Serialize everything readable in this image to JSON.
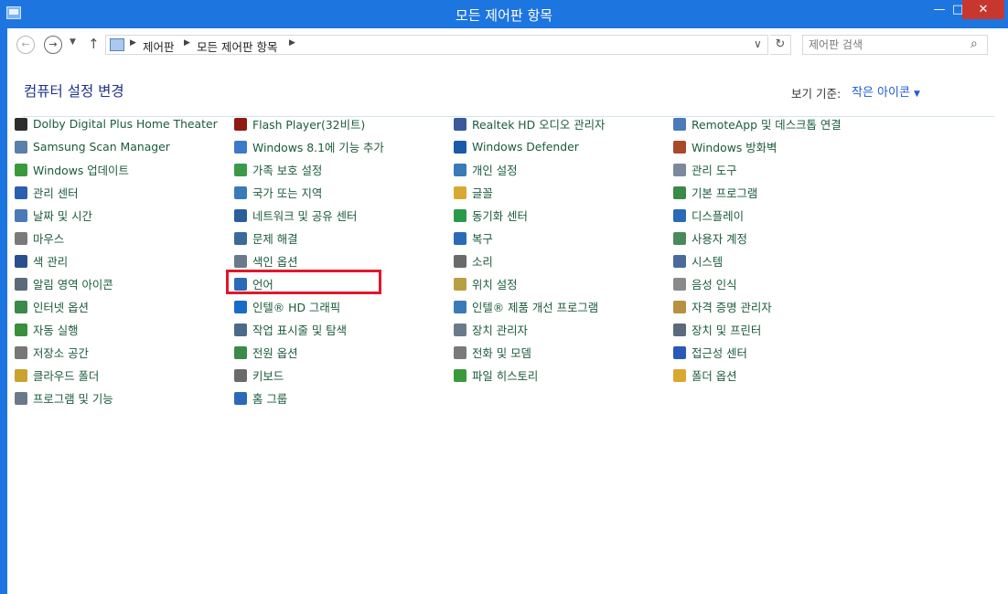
{
  "window": {
    "title": "모든 제어판 항목",
    "minimize": "—",
    "maximize": "□",
    "close": "✕"
  },
  "nav": {
    "back": "←",
    "forward": "→",
    "recent": "▼",
    "up": "↑",
    "breadcrumbs": [
      "제어판",
      "모든 제어판 항목"
    ],
    "separator": "▶",
    "dropdown": "∨",
    "refresh": "↻",
    "search_placeholder": "제어판 검색"
  },
  "header": {
    "title": "컴퓨터 설정 변경",
    "view_label": "보기 기준:",
    "view_value": "작은 아이콘"
  },
  "columns": [
    [
      {
        "label": "Dolby Digital Plus Home Theater",
        "icon": "dolby-icon",
        "color": "#2d2d2d"
      },
      {
        "label": "Samsung Scan Manager",
        "icon": "scanner-icon",
        "color": "#5a7fa8"
      },
      {
        "label": "Windows 업데이트",
        "icon": "windows-update-icon",
        "color": "#3a9a3a"
      },
      {
        "label": "관리 센터",
        "icon": "flag-icon",
        "color": "#2b5fb0"
      },
      {
        "label": "날짜 및 시간",
        "icon": "calendar-clock-icon",
        "color": "#4a7ab8"
      },
      {
        "label": "마우스",
        "icon": "mouse-icon",
        "color": "#7a7a7a"
      },
      {
        "label": "색 관리",
        "icon": "color-management-icon",
        "color": "#2a4f8f"
      },
      {
        "label": "알림 영역 아이콘",
        "icon": "notification-area-icon",
        "color": "#5d6a78"
      },
      {
        "label": "인터넷 옵션",
        "icon": "internet-options-icon",
        "color": "#3a8a4a"
      },
      {
        "label": "자동 실행",
        "icon": "autoplay-icon",
        "color": "#3a8f3a"
      },
      {
        "label": "저장소 공간",
        "icon": "storage-spaces-icon",
        "color": "#777777"
      },
      {
        "label": "클라우드 폴더",
        "icon": "work-folders-icon",
        "color": "#c9a230"
      },
      {
        "label": "프로그램 및 기능",
        "icon": "programs-features-icon",
        "color": "#6a7a8a"
      }
    ],
    [
      {
        "label": "Flash Player(32비트)",
        "icon": "flash-icon",
        "color": "#8e1a12"
      },
      {
        "label": "Windows 8.1에 기능 추가",
        "icon": "add-features-icon",
        "color": "#3a7ac8"
      },
      {
        "label": "가족 보호 설정",
        "icon": "family-safety-icon",
        "color": "#3a9a4a"
      },
      {
        "label": "국가 또는 지역",
        "icon": "region-icon",
        "color": "#3a7ab8"
      },
      {
        "label": "네트워크 및 공유 센터",
        "icon": "network-icon",
        "color": "#2a5f9a"
      },
      {
        "label": "문제 해결",
        "icon": "troubleshooting-icon",
        "color": "#3a6a9a"
      },
      {
        "label": "색인 옵션",
        "icon": "indexing-icon",
        "color": "#6a7a8a"
      },
      {
        "label": "언어",
        "icon": "language-icon",
        "color": "#2a6ab8"
      },
      {
        "label": "인텔® HD 그래픽",
        "icon": "intel-graphics-icon",
        "color": "#1a6ac8"
      },
      {
        "label": "작업 표시줄 및 탐색",
        "icon": "taskbar-icon",
        "color": "#4a6a8a"
      },
      {
        "label": "전원 옵션",
        "icon": "power-options-icon",
        "color": "#3a8a4a"
      },
      {
        "label": "키보드",
        "icon": "keyboard-icon",
        "color": "#6a6a6a"
      },
      {
        "label": "홈 그룹",
        "icon": "homegroup-icon",
        "color": "#2a6ab8"
      }
    ],
    [
      {
        "label": "Realtek HD 오디오 관리자",
        "icon": "realtek-audio-icon",
        "color": "#3a5a9a"
      },
      {
        "label": "Windows Defender",
        "icon": "defender-icon",
        "color": "#1a5aa8"
      },
      {
        "label": "개인 설정",
        "icon": "personalization-icon",
        "color": "#3a7ab8"
      },
      {
        "label": "글꼴",
        "icon": "fonts-icon",
        "color": "#d9a830"
      },
      {
        "label": "동기화 센터",
        "icon": "sync-center-icon",
        "color": "#2a9a4a"
      },
      {
        "label": "복구",
        "icon": "recovery-icon",
        "color": "#2a6ab8"
      },
      {
        "label": "소리",
        "icon": "sound-icon",
        "color": "#6a6a6a"
      },
      {
        "label": "위치 설정",
        "icon": "location-icon",
        "color": "#b8a040"
      },
      {
        "label": "인텔® 제품 개선 프로그램",
        "icon": "intel-improvement-icon",
        "color": "#3a7ab8"
      },
      {
        "label": "장치 관리자",
        "icon": "device-manager-icon",
        "color": "#6a7a8a"
      },
      {
        "label": "전화 및 모뎀",
        "icon": "phone-modem-icon",
        "color": "#7a7a7a"
      },
      {
        "label": "파일 히스토리",
        "icon": "file-history-icon",
        "color": "#3a9a3a"
      }
    ],
    [
      {
        "label": "RemoteApp 및 데스크톱 연결",
        "icon": "remoteapp-icon",
        "color": "#4a7ab8"
      },
      {
        "label": "Windows 방화벽",
        "icon": "firewall-icon",
        "color": "#a84a2a"
      },
      {
        "label": "관리 도구",
        "icon": "admin-tools-icon",
        "color": "#7a8a9a"
      },
      {
        "label": "기본 프로그램",
        "icon": "default-programs-icon",
        "color": "#3a8a4a"
      },
      {
        "label": "디스플레이",
        "icon": "display-icon",
        "color": "#2a6ab8"
      },
      {
        "label": "사용자 계정",
        "icon": "user-accounts-icon",
        "color": "#4a8a5a"
      },
      {
        "label": "시스템",
        "icon": "system-icon",
        "color": "#4a6a9a"
      },
      {
        "label": "음성 인식",
        "icon": "speech-recognition-icon",
        "color": "#8a8a8a"
      },
      {
        "label": "자격 증명 관리자",
        "icon": "credential-manager-icon",
        "color": "#b89040"
      },
      {
        "label": "장치 및 프린터",
        "icon": "devices-printers-icon",
        "color": "#5a6a7a"
      },
      {
        "label": "접근성 센터",
        "icon": "ease-of-access-icon",
        "color": "#2a5ab8"
      },
      {
        "label": "폴더 옵션",
        "icon": "folder-options-icon",
        "color": "#d9a830"
      }
    ]
  ]
}
